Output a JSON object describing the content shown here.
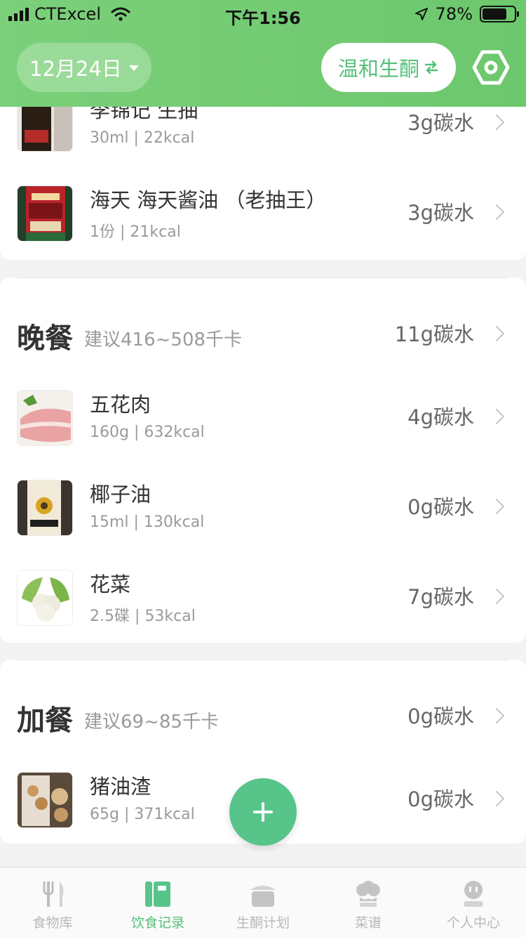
{
  "status_bar": {
    "carrier": "CTExcel",
    "time": "下午1:56",
    "battery_percent": "78%",
    "battery_level": 0.78
  },
  "header": {
    "date_label": "12月24日",
    "mode_label": "温和生酮",
    "settings_icon": "settings-hex-icon",
    "accent_color": "#6cc76d"
  },
  "top_items": [
    {
      "name": "李锦记 生抽",
      "detail": "30ml | 22kcal",
      "carb": "3g碳水"
    },
    {
      "name": "海天 海天酱油 （老抽王）",
      "detail": "1份 | 21kcal",
      "carb": "3g碳水"
    }
  ],
  "dinner": {
    "title": "晚餐",
    "suggestion": "建议416~508千卡",
    "carb": "11g碳水",
    "items": [
      {
        "name": "五花肉",
        "detail": "160g | 632kcal",
        "carb": "4g碳水"
      },
      {
        "name": "椰子油",
        "detail": "15ml | 130kcal",
        "carb": "0g碳水"
      },
      {
        "name": "花菜",
        "detail": "2.5碟 | 53kcal",
        "carb": "7g碳水"
      }
    ]
  },
  "snack": {
    "title": "加餐",
    "suggestion": "建议69~85千卡",
    "carb": "0g碳水",
    "items": [
      {
        "name": "猪油渣",
        "detail": "65g | 371kcal",
        "carb": "0g碳水"
      }
    ]
  },
  "tabs": [
    {
      "label": "食物库",
      "icon": "fork-knife-icon"
    },
    {
      "label": "饮食记录",
      "icon": "notebook-icon"
    },
    {
      "label": "生酮计划",
      "icon": "pot-icon"
    },
    {
      "label": "菜谱",
      "icon": "chef-hat-icon"
    },
    {
      "label": "个人中心",
      "icon": "profile-icon"
    }
  ],
  "active_tab": "饮食记录"
}
